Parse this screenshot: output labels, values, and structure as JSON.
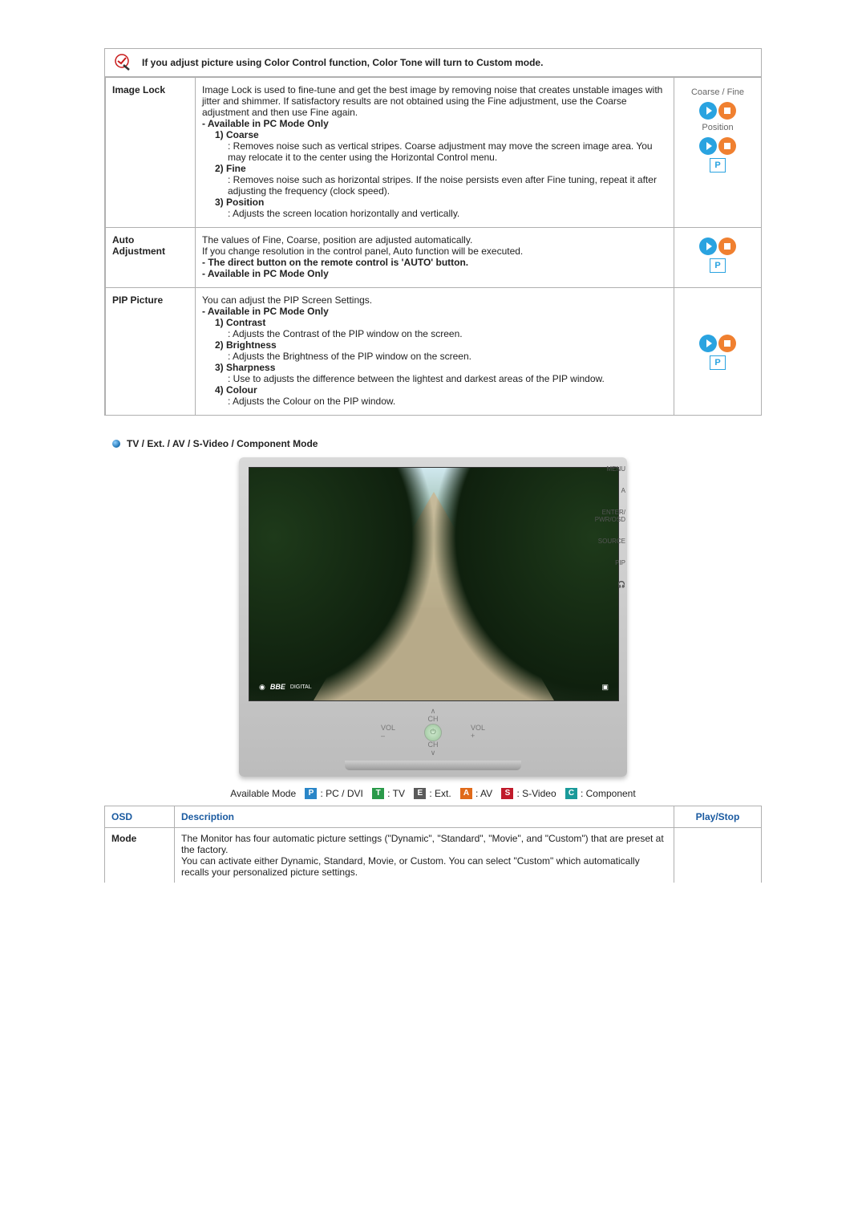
{
  "notice": {
    "text": "If you adjust picture using Color Control function, Color Tone will turn to Custom mode."
  },
  "rows": [
    {
      "name": "Image Lock",
      "intro": "Image Lock is used to fine-tune and get the best image by removing noise that creates unstable images with jitter and shimmer. If satisfactory results are not obtained using the Fine adjustment, use the Coarse adjustment and then use Fine again.",
      "note1": "- Available in PC Mode Only",
      "opt1_title": "1) Coarse",
      "opt1_body": ": Removes noise such as vertical stripes. Coarse adjustment may move the screen image area. You may relocate it to the center using the Horizontal Control menu.",
      "opt2_title": "2) Fine",
      "opt2_body": ": Removes noise such as horizontal stripes. If the noise persists even after Fine tuning, repeat it after adjusting the frequency (clock speed).",
      "opt3_title": "3) Position",
      "opt3_body": ": Adjusts the screen location horizontally and vertically.",
      "play_label1": "Coarse / Fine",
      "play_label2": "Position"
    },
    {
      "name": "Auto Adjustment",
      "intro": "The values of Fine, Coarse, position are adjusted automatically.\nIf you change resolution in the control panel, Auto function will be executed.",
      "note1": "- The direct button on the remote control is 'AUTO' button.",
      "note2": "- Available in PC Mode Only"
    },
    {
      "name": "PIP Picture",
      "intro": "You can adjust the PIP Screen Settings.",
      "note1": "- Available in PC Mode Only",
      "opt1_title": "1) Contrast",
      "opt1_body": ": Adjusts the Contrast of the PIP window on the screen.",
      "opt2_title": "2) Brightness",
      "opt2_body": ": Adjusts the Brightness of the PIP window on the screen.",
      "opt3_title": "3) Sharpness",
      "opt3_body": ": Use to adjusts the difference between the lightest and darkest areas of the PIP window.",
      "opt4_title": "4) Colour",
      "opt4_body": ": Adjusts the Colour on the PIP window."
    }
  ],
  "section2": {
    "title": "TV / Ext. / AV / S-Video / Component Mode",
    "monitor": {
      "side": {
        "menu": "MENU",
        "av": "A",
        "enter": "ENTER/\nPWR/OSD",
        "source": "SOURCE",
        "pip": "PIP"
      },
      "ctrl": {
        "ch_up": "∧",
        "ch_up_l": "CH",
        "vol_m": "VOL\n–",
        "vol_p": "VOL\n+",
        "ch_dn": "CH",
        "ch_dn_s": "∨"
      },
      "osd_logo": "BBE",
      "osd_sub": "DIGITAL"
    },
    "mode_line": {
      "label": "Available Mode",
      "p": "P",
      "p_l": ": PC / DVI",
      "t": "T",
      "t_l": ": TV",
      "e": "E",
      "e_l": ": Ext.",
      "a": "A",
      "a_l": ": AV",
      "s": "S",
      "s_l": ": S-Video",
      "c": "C",
      "c_l": ": Component"
    },
    "table": {
      "h_osd": "OSD",
      "h_desc": "Description",
      "h_play": "Play/Stop",
      "r1_osd": "Mode",
      "r1_desc": "The Monitor has four automatic picture settings (\"Dynamic\", \"Standard\", \"Movie\", and \"Custom\") that are preset at the factory.\nYou can activate either Dynamic, Standard, Movie, or Custom. You can select \"Custom\" which automatically recalls your personalized picture settings."
    }
  }
}
